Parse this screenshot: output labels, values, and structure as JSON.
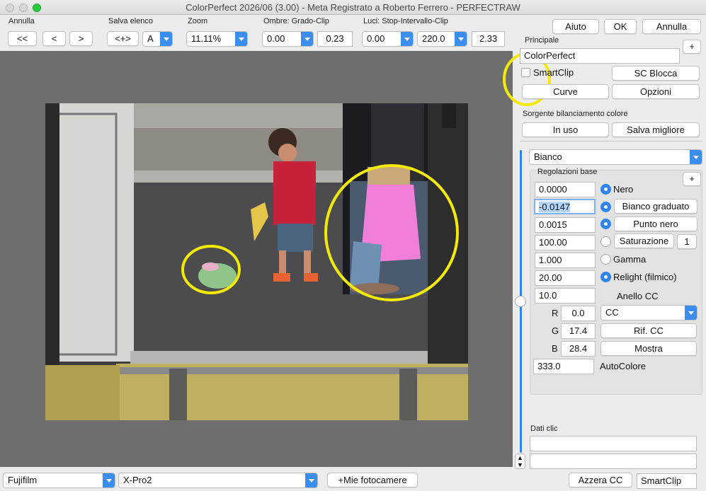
{
  "window": {
    "title": "ColorPerfect 2026/06 (3.00) -  Meta Registrato a Roberto Ferrero - PERFECTRAW"
  },
  "toolbar": {
    "annulla_label": "Annulla",
    "nav_first": "<<",
    "nav_prev": "<",
    "nav_next": ">",
    "salva_elenco_label": "Salva elenco",
    "swap_button": "<+>",
    "slot_value": "A",
    "zoom_label": "Zoom",
    "zoom_value": "11.11%",
    "ombre_label": "Ombre: Grado-Clip",
    "ombre_grado": "0.00",
    "ombre_clip": "0.23",
    "luci_label": "Luci: Stop-Intervallo-Clip",
    "luci_stop": "0.00",
    "luci_intervallo": "220.0",
    "luci_clip": "2.33"
  },
  "topright": {
    "aiuto": "Aiuto",
    "ok": "OK",
    "annulla": "Annulla"
  },
  "principale": {
    "label": "Principale",
    "plus": "+",
    "name_value": "ColorPerfect",
    "smartclip_label": "SmartClip",
    "smartclip_checked": false,
    "sc_blocca": "SC Blocca",
    "curve": "Curve",
    "opzioni": "Opzioni",
    "sorgente_label": "Sorgente bilanciamento colore",
    "in_uso": "In uso",
    "salva_migliore": "Salva migliore"
  },
  "base": {
    "mode_value": "Bianco",
    "group_label": "Regolazioni base",
    "plus": "+",
    "nero_value": "0.0000",
    "nero_label": "Nero",
    "bianco_value": "-0.0147",
    "bianco_graduato": "Bianco graduato",
    "punto_value": "0.0015",
    "punto_nero": "Punto nero",
    "sat_value": "100.00",
    "saturazione": "Saturazione",
    "sat_step": "1",
    "gamma_value": "1.000",
    "gamma_label": "Gamma",
    "relight_value": "20.00",
    "relight_label": "Relight (filmico)",
    "anello_value": "10.0",
    "anello_label": "Anello CC",
    "r_label": "R",
    "r_value": "0.0",
    "g_label": "G",
    "g_value": "17.4",
    "b_label": "B",
    "b_value": "28.4",
    "cc_value": "CC",
    "rif_cc": "Rif. CC",
    "mostra": "Mostra",
    "autocolore_value": "333.0",
    "autocolore_label": "AutoColore"
  },
  "dati": {
    "label": "Dati clic",
    "line1": "",
    "line2": ""
  },
  "bottom": {
    "brand_value": "Fujifilm",
    "model_value": "X-Pro2",
    "mie_fotocamere": "+Mie fotocamere",
    "azzera_cc": "Azzera CC",
    "smartclip": "SmartClip"
  },
  "colors": {
    "accent": "#2f84ee",
    "annotation": "#f2ea00",
    "bag_pink": "#f07fd8",
    "shirt": "#c8213a"
  }
}
